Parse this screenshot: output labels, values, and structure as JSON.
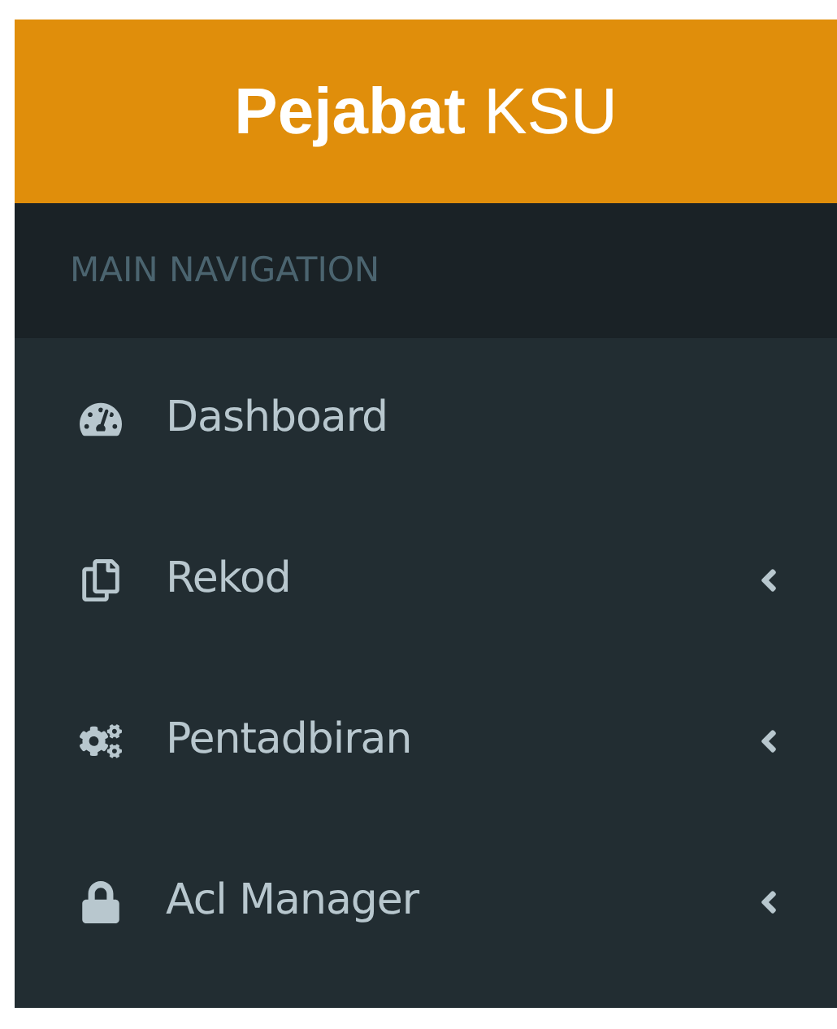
{
  "logo": "**Pejabat** KSU",
  "nav_header": "MAIN NAVIGATION",
  "menu_items": [
    {
      "label": "Dashboard",
      "has_submenu": false
    },
    {
      "label": "Rekod",
      "has_submenu": true
    },
    {
      "label": "Pentadbiran",
      "has_submenu": true
    },
    {
      "label": "Acl Manager",
      "has_submenu": true
    }
  ]
}
